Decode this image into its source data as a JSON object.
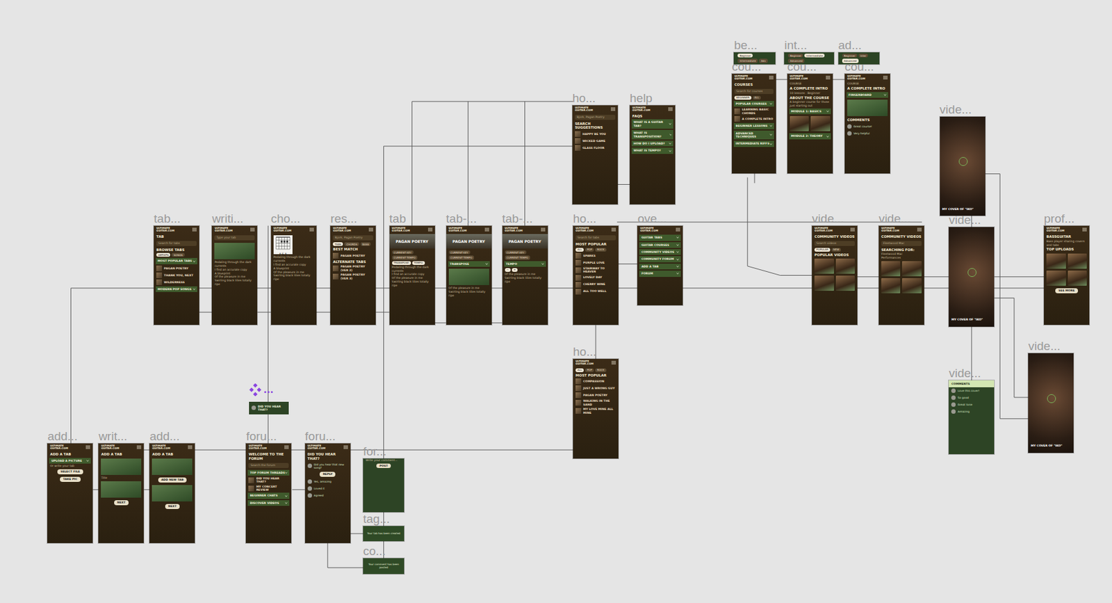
{
  "logo": "ULTIMATE GUITAR.COM",
  "component": {
    "dots": "...",
    "card": "DID YOU HEAR THAT?"
  },
  "frames": [
    {
      "label": "be...",
      "kind": "bar",
      "items": [
        {
          "kind": "chips",
          "chips": [
            {
              "text": "Beginner",
              "selected": true
            },
            {
              "text": "Intermediate",
              "selected": false
            },
            {
              "text": "Adv",
              "selected": false
            }
          ]
        }
      ]
    },
    {
      "label": "int...",
      "kind": "bar",
      "items": [
        {
          "kind": "chips",
          "chips": [
            {
              "text": "Beginner",
              "selected": false
            },
            {
              "text": "Intermediate",
              "selected": true
            },
            {
              "text": "Advanced",
              "selected": false
            }
          ]
        }
      ]
    },
    {
      "label": "ad...",
      "kind": "bar",
      "items": [
        {
          "kind": "chips",
          "chips": [
            {
              "text": "Beginner",
              "selected": false
            },
            {
              "text": "Inter",
              "selected": false
            },
            {
              "text": "Advanced",
              "selected": true
            }
          ]
        }
      ]
    },
    {
      "label": "cou...",
      "kind": "brown",
      "items": [
        {
          "kind": "title",
          "text": "COURSES"
        },
        {
          "kind": "search",
          "text": "Search for courses"
        },
        {
          "kind": "chips",
          "chips": [
            {
              "text": "BEGINNER",
              "selected": true
            },
            {
              "text": "ALL",
              "selected": false
            }
          ]
        },
        {
          "kind": "section",
          "text": "POPULAR COURSES"
        },
        {
          "kind": "row",
          "text": "LEARNING BASIC CHORDS"
        },
        {
          "kind": "row",
          "text": "A COMPLETE INTRO"
        },
        {
          "kind": "section",
          "text": "BEGINNER LESSONS"
        },
        {
          "kind": "section",
          "text": "ADVANCED TECHNIQUES"
        },
        {
          "kind": "section",
          "text": "INTERMEDIATE RIFFS"
        }
      ]
    },
    {
      "label": "cou...",
      "kind": "brown",
      "items": [
        {
          "kind": "text",
          "text": "COURSE"
        },
        {
          "kind": "title",
          "text": "A COMPLETE INTRO"
        },
        {
          "kind": "text",
          "text": "10 lessons · Beginner"
        },
        {
          "kind": "title",
          "text": "ABOUT THE COURSE"
        },
        {
          "kind": "text",
          "text": "A beginner course for those just starting out"
        },
        {
          "kind": "section",
          "text": "MODULE 1: BASICS"
        },
        {
          "kind": "thumbs",
          "count": 2
        },
        {
          "kind": "section",
          "text": "MODULE 2: THEORY"
        }
      ]
    },
    {
      "label": "cou...",
      "kind": "brown",
      "items": [
        {
          "kind": "text",
          "text": "COURSE"
        },
        {
          "kind": "title",
          "text": "A COMPLETE INTRO"
        },
        {
          "kind": "section",
          "text": "FINGERBOARD"
        },
        {
          "kind": "image"
        },
        {
          "kind": "title",
          "text": "COMMENTS"
        },
        {
          "kind": "comment",
          "text": "Great course!"
        },
        {
          "kind": "comment",
          "text": "Very helpful"
        }
      ]
    },
    {
      "label": "ho...",
      "kind": "brown",
      "items": [
        {
          "kind": "search",
          "text": "Bjork, Pagan Poetry"
        },
        {
          "kind": "title",
          "text": "SEARCH SUGGESTIONS"
        },
        {
          "kind": "row",
          "text": "HAPPY BE YOU"
        },
        {
          "kind": "row",
          "text": "WICKED GAME"
        },
        {
          "kind": "row",
          "text": "GLASS FLOOR"
        }
      ]
    },
    {
      "label": "help",
      "kind": "brown",
      "items": [
        {
          "kind": "title",
          "text": "FAQS"
        },
        {
          "kind": "section",
          "text": "WHAT IS A GUITAR TAB?"
        },
        {
          "kind": "section",
          "text": "WHAT IS TRANSPOSITION?"
        },
        {
          "kind": "section",
          "text": "HOW DO I UPLOAD?"
        },
        {
          "kind": "section",
          "text": "WHAT IS TEMPO?"
        }
      ]
    },
    {
      "label": "vide...",
      "kind": "video",
      "caption": "MY COVER OF \"IKO\"",
      "items": []
    },
    {
      "label": "tab...",
      "kind": "brown",
      "items": [
        {
          "kind": "title",
          "text": "TAB"
        },
        {
          "kind": "search",
          "text": "Search for tabs"
        },
        {
          "kind": "title",
          "text": "BROWSE TABS"
        },
        {
          "kind": "chips",
          "chips": [
            {
              "text": "ARTISTS",
              "selected": true
            },
            {
              "text": "SONGS",
              "selected": false
            }
          ]
        },
        {
          "kind": "section",
          "text": "MOST POPULAR TABS"
        },
        {
          "kind": "row",
          "text": "PAGAN POETRY"
        },
        {
          "kind": "row",
          "text": "THANK YOU, NEXT"
        },
        {
          "kind": "row",
          "text": "WILDERNESS"
        },
        {
          "kind": "section",
          "text": "MODERN POP SONGS"
        }
      ]
    },
    {
      "label": "writi...",
      "kind": "brown",
      "items": [
        {
          "kind": "search",
          "text": "Type your tab"
        },
        {
          "kind": "image"
        },
        {
          "kind": "text",
          "text": "Pedaling through the dark currents"
        },
        {
          "kind": "text",
          "text": "I find an accurate copy"
        },
        {
          "kind": "text",
          "text": "A blueprint"
        },
        {
          "kind": "text",
          "text": "Of the pleasure in me"
        },
        {
          "kind": "text",
          "text": "Swirling black lilies totally ripe"
        }
      ]
    },
    {
      "label": "cho...",
      "kind": "brown",
      "items": [
        {
          "kind": "chord",
          "text": "A E A"
        },
        {
          "kind": "text",
          "text": "Pedaling through the dark currents"
        },
        {
          "kind": "text",
          "text": "I find an accurate copy"
        },
        {
          "kind": "text",
          "text": "A blueprint"
        },
        {
          "kind": "text",
          "text": "Of the pleasure in me"
        },
        {
          "kind": "text",
          "text": "Swirling black lilies totally ripe"
        }
      ]
    },
    {
      "label": "res...",
      "kind": "brown",
      "items": [
        {
          "kind": "search",
          "text": "Bjork, Pagan Poetry"
        },
        {
          "kind": "chips",
          "chips": [
            {
              "text": "TABS",
              "selected": true
            },
            {
              "text": "CHORDS",
              "selected": false
            },
            {
              "text": "BASS",
              "selected": false
            }
          ]
        },
        {
          "kind": "title",
          "text": "BEST MATCH"
        },
        {
          "kind": "row",
          "text": "PAGAN POETRY"
        },
        {
          "kind": "title",
          "text": "ALTERNATE TABS"
        },
        {
          "kind": "row",
          "text": "PAGAN POETRY (VER 2)"
        },
        {
          "kind": "row",
          "text": "PAGAN POETRY (VER 3)"
        }
      ]
    },
    {
      "label": "tab",
      "kind": "brown",
      "items": [
        {
          "kind": "hero",
          "text": "PAGAN POETRY"
        },
        {
          "kind": "chips",
          "chips": [
            {
              "text": "CURRENT KEY",
              "selected": false
            },
            {
              "text": "CURRENT TEMPO",
              "selected": false
            }
          ]
        },
        {
          "kind": "chips",
          "chips": [
            {
              "text": "TRANSPOSE",
              "selected": true
            },
            {
              "text": "TEMPO",
              "selected": true
            }
          ]
        },
        {
          "kind": "text",
          "text": "Pedaling through the dark currents"
        },
        {
          "kind": "text",
          "text": "I find an accurate copy"
        },
        {
          "kind": "text",
          "text": "Of the pleasure in me"
        },
        {
          "kind": "text",
          "text": "Swirling black lilies totally ripe"
        }
      ]
    },
    {
      "label": "tab-...",
      "kind": "brown",
      "items": [
        {
          "kind": "hero",
          "text": "PAGAN POETRY"
        },
        {
          "kind": "chips",
          "chips": [
            {
              "text": "CURRENT KEY",
              "selected": false
            },
            {
              "text": "CURRENT TEMPO",
              "selected": false
            }
          ]
        },
        {
          "kind": "section",
          "text": "TRANSPOSE"
        },
        {
          "kind": "image"
        },
        {
          "kind": "text",
          "text": "Of the pleasure in me"
        },
        {
          "kind": "text",
          "text": "Swirling black lilies totally ripe"
        }
      ]
    },
    {
      "label": "tab-...",
      "kind": "brown",
      "items": [
        {
          "kind": "hero",
          "text": "PAGAN POETRY"
        },
        {
          "kind": "chips",
          "chips": [
            {
              "text": "CURRENT KEY",
              "selected": false
            },
            {
              "text": "CURRENT TEMPO",
              "selected": false
            }
          ]
        },
        {
          "kind": "section",
          "text": "TEMPO"
        },
        {
          "kind": "chips",
          "chips": [
            {
              "text": "−",
              "selected": true
            },
            {
              "text": "+",
              "selected": true
            }
          ]
        },
        {
          "kind": "text",
          "text": "Of the pleasure in me"
        },
        {
          "kind": "text",
          "text": "Swirling black lilies totally ripe"
        }
      ]
    },
    {
      "label": "ho...",
      "kind": "brown",
      "items": [
        {
          "kind": "search",
          "text": "Search for tabs"
        },
        {
          "kind": "title",
          "text": "MOST POPULAR"
        },
        {
          "kind": "chips",
          "chips": [
            {
              "text": "ALL",
              "selected": true
            },
            {
              "text": "POP",
              "selected": false
            },
            {
              "text": "ROCK",
              "selected": false
            }
          ]
        },
        {
          "kind": "row",
          "text": "SPARKS"
        },
        {
          "kind": "row",
          "text": "PURPLE LOVE"
        },
        {
          "kind": "row",
          "text": "STAIRWAY TO HEAVEN"
        },
        {
          "kind": "row",
          "text": "LOVELY DAY"
        },
        {
          "kind": "row",
          "text": "CHERRY WINE"
        },
        {
          "kind": "row",
          "text": "ALL TOO WELL"
        }
      ]
    },
    {
      "label": "ove...",
      "kind": "brown",
      "items": [
        {
          "kind": "section",
          "text": "GUITAR TABS"
        },
        {
          "kind": "section",
          "text": "GUITAR COURSES"
        },
        {
          "kind": "section",
          "text": "COMMUNITY VIDEOS"
        },
        {
          "kind": "section",
          "text": "COMMUNITY FORUM"
        },
        {
          "kind": "section",
          "text": "ADD A TAB"
        },
        {
          "kind": "section",
          "text": "FORUM"
        }
      ]
    },
    {
      "label": "vide...",
      "kind": "brown",
      "items": [
        {
          "kind": "title",
          "text": "COMMUNITY VIDEOS"
        },
        {
          "kind": "search",
          "text": "Search videos"
        },
        {
          "kind": "chips",
          "chips": [
            {
              "text": "POPULAR",
              "selected": true
            },
            {
              "text": "NEW",
              "selected": false
            }
          ]
        },
        {
          "kind": "title",
          "text": "POPULAR VIDEOS"
        },
        {
          "kind": "thumbs",
          "count": 4
        }
      ]
    },
    {
      "label": "vide...",
      "kind": "brown",
      "items": [
        {
          "kind": "title",
          "text": "COMMUNITY VIDEOS"
        },
        {
          "kind": "search",
          "text": "Fleetwood Mac"
        },
        {
          "kind": "title",
          "text": "SEARCHING FOR:"
        },
        {
          "kind": "text",
          "text": "Fleetwood Mac Performances"
        },
        {
          "kind": "thumbs",
          "count": 4
        }
      ]
    },
    {
      "label": "vide...",
      "kind": "video",
      "caption": "MY COVER OF \"IKO\"",
      "items": []
    },
    {
      "label": "prof...",
      "kind": "brown",
      "items": [
        {
          "kind": "title",
          "text": "BASSGUITAR"
        },
        {
          "kind": "text",
          "text": "Bass player sharing covers and tabs"
        },
        {
          "kind": "title",
          "text": "TOP UPLOADS"
        },
        {
          "kind": "thumbs",
          "count": 4
        },
        {
          "kind": "button",
          "text": "SEE MORE"
        }
      ]
    },
    {
      "label": "ho...",
      "kind": "brown",
      "items": [
        {
          "kind": "chips",
          "chips": [
            {
              "text": "ALL",
              "selected": true
            },
            {
              "text": "POP",
              "selected": false
            },
            {
              "text": "ROCK",
              "selected": false
            }
          ]
        },
        {
          "kind": "title",
          "text": "MOST POPULAR"
        },
        {
          "kind": "row",
          "text": "COMPASSION"
        },
        {
          "kind": "row",
          "text": "JUST A WRONG GUY"
        },
        {
          "kind": "row",
          "text": "PAGAN POETRY"
        },
        {
          "kind": "row",
          "text": "WALKING IN THE SAND"
        },
        {
          "kind": "row",
          "text": "MY LOVE MINE ALL MINE"
        }
      ]
    },
    {
      "label": "vide...",
      "kind": "video",
      "caption": "MY COVER OF \"IKO\"",
      "items": []
    },
    {
      "label": "vide...",
      "kind": "green",
      "items": [
        {
          "kind": "bartitle",
          "text": "COMMENTS"
        },
        {
          "kind": "comment",
          "text": "Love this cover!"
        },
        {
          "kind": "comment",
          "text": "So good"
        },
        {
          "kind": "comment",
          "text": "Great tone"
        },
        {
          "kind": "comment",
          "text": "Amazing"
        }
      ]
    },
    {
      "label": "add...",
      "kind": "brown",
      "items": [
        {
          "kind": "title",
          "text": "ADD A TAB"
        },
        {
          "kind": "section",
          "text": "UPLOAD A PICTURE"
        },
        {
          "kind": "text",
          "text": "Or write your tab"
        },
        {
          "kind": "button",
          "text": "SELECT FILE"
        },
        {
          "kind": "button",
          "text": "TAKE PIC"
        }
      ]
    },
    {
      "label": "writ...",
      "kind": "brown",
      "items": [
        {
          "kind": "title",
          "text": "ADD A TAB"
        },
        {
          "kind": "image"
        },
        {
          "kind": "text",
          "text": "Title"
        },
        {
          "kind": "image"
        },
        {
          "kind": "button",
          "text": "NEXT"
        }
      ]
    },
    {
      "label": "add...",
      "kind": "brown",
      "items": [
        {
          "kind": "title",
          "text": "ADD A TAB"
        },
        {
          "kind": "image"
        },
        {
          "kind": "button",
          "text": "ADD NEW TAB"
        },
        {
          "kind": "image"
        },
        {
          "kind": "button",
          "text": "NEXT"
        }
      ]
    },
    {
      "label": "foru...",
      "kind": "brown",
      "items": [
        {
          "kind": "title",
          "text": "WELCOME TO THE FORUM"
        },
        {
          "kind": "search",
          "text": "Search the forum"
        },
        {
          "kind": "section",
          "text": "TOP FORUM THREADS"
        },
        {
          "kind": "row",
          "text": "DID YOU HEAR THAT?"
        },
        {
          "kind": "row",
          "text": "MY CONCERT REVIEW"
        },
        {
          "kind": "section",
          "text": "BEGINNER CHATS"
        },
        {
          "kind": "section",
          "text": "DISCOVER VIDEOS"
        }
      ]
    },
    {
      "label": "foru...",
      "kind": "brown",
      "items": [
        {
          "kind": "title",
          "text": "DID YOU HEAR THAT?"
        },
        {
          "kind": "comment",
          "text": "Did you hear that new song?"
        },
        {
          "kind": "button",
          "text": "REPLY"
        },
        {
          "kind": "comment",
          "text": "Yes, amazing"
        },
        {
          "kind": "comment",
          "text": "Loved it"
        },
        {
          "kind": "comment",
          "text": "Agreed"
        }
      ]
    },
    {
      "label": "for...",
      "kind": "green",
      "items": [
        {
          "kind": "text",
          "text": "Write your comment..."
        },
        {
          "kind": "button",
          "text": "POST"
        }
      ]
    },
    {
      "label": "tag...",
      "kind": "toast",
      "items": [
        {
          "kind": "toast",
          "text": "Your tab has been created"
        }
      ]
    },
    {
      "label": "co...",
      "kind": "toast",
      "items": [
        {
          "kind": "toast",
          "text": "Your comment has been posted"
        }
      ]
    }
  ]
}
